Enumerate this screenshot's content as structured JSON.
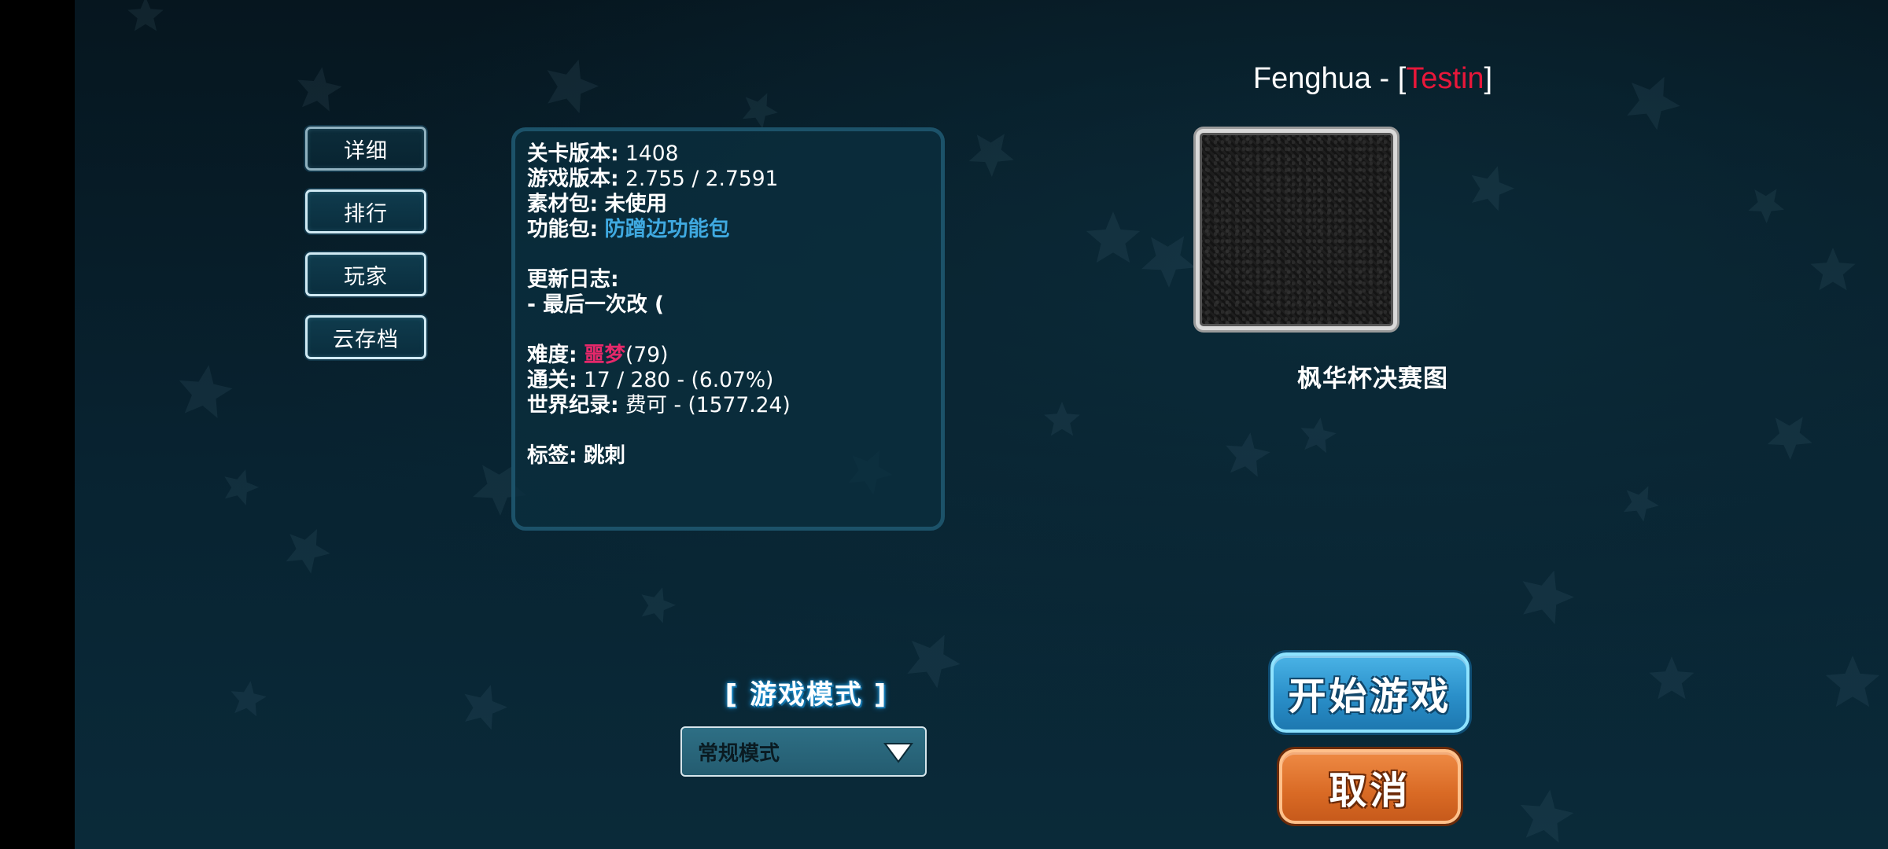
{
  "sidebar": {
    "items": [
      {
        "label": "详细"
      },
      {
        "label": "排行"
      },
      {
        "label": "玩家"
      },
      {
        "label": "云存档"
      }
    ]
  },
  "info": {
    "level_version_key": "关卡版本:",
    "level_version_value": "1408",
    "game_version_key": "游戏版本:",
    "game_version_value": "2.755 / 2.7591",
    "asset_pack_key": "素材包:",
    "asset_pack_value": "未使用",
    "feature_pack_key": "功能包:",
    "feature_pack_value": "防蹭边功能包",
    "changelog_key": "更新日志:",
    "changelog_line": " - 最后一次改 (",
    "difficulty_key": "难度:",
    "difficulty_name": "噩梦",
    "difficulty_value": "(79)",
    "clears_key": "通关:",
    "clears_value": "17 / 280 - (6.07%)",
    "world_record_key": "世界纪录:",
    "world_record_value": "费可 - (1577.24)",
    "tags_key": "标签:",
    "tags_value": "跳刺"
  },
  "level": {
    "title_prefix": "Fenghua - [",
    "author": "Testin",
    "title_suffix": "]",
    "map_name": "枫华杯决赛图"
  },
  "mode": {
    "label": "[ 游戏模式 ]",
    "selected": "常规模式"
  },
  "actions": {
    "start_label": "开始游戏",
    "cancel_label": "取消"
  },
  "colors": {
    "background": "#082331",
    "panel_border": "#1c5269",
    "author_red": "#e8173a",
    "feature_blue": "#3fa9e0",
    "difficulty_red": "#e5286a",
    "start_blue": "#2a8fc9",
    "cancel_orange": "#d96a25"
  },
  "icons": {
    "dropdown": "triangle-down-icon",
    "background": "star-pattern"
  }
}
